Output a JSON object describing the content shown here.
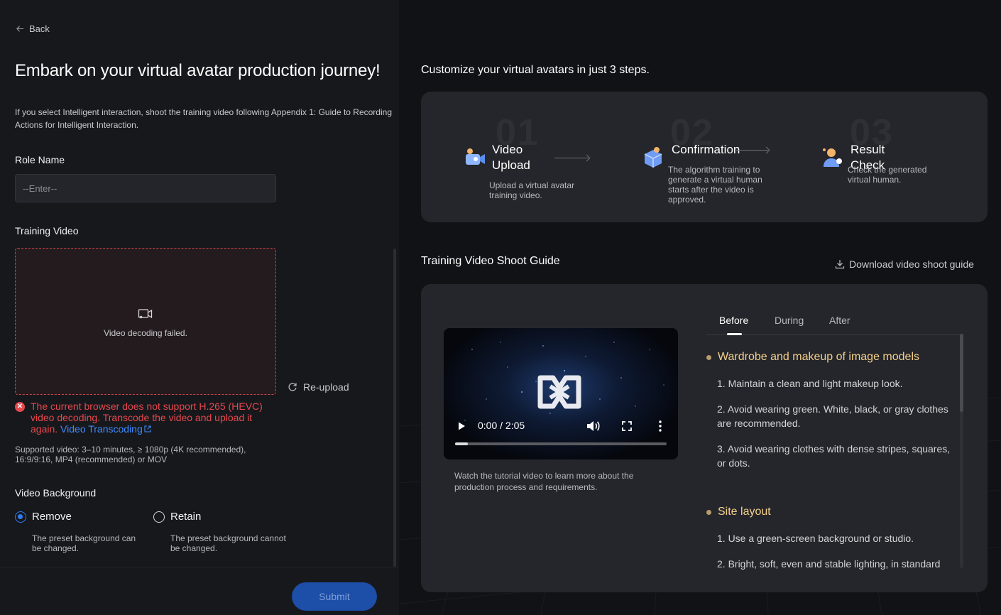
{
  "nav": {
    "back_label": "Back"
  },
  "page": {
    "title": "Embark on your virtual avatar production journey!",
    "intro": "If you select Intelligent interaction, shoot the training video following Appendix 1: Guide to Recording Actions for Intelligent Interaction."
  },
  "form": {
    "role_name_label": "Role Name",
    "role_name_value": "",
    "role_name_placeholder": "--Enter--",
    "training_video_label": "Training Video",
    "upload_status": "Video decoding failed.",
    "reupload_label": "Re-upload",
    "error_text": "The current browser does not support H.265 (HEVC) video decoding. Transcode the video and upload it again.",
    "error_link": "Video Transcoding",
    "support_text": "Supported video: 3–10 minutes, ≥ 1080p (4K recommended), 16:9/9:16, MP4 (recommended) or MOV",
    "background_label": "Video Background",
    "background_options": [
      {
        "label": "Remove",
        "desc": "The preset background can be changed.",
        "selected": true
      },
      {
        "label": "Retain",
        "desc": "The preset background cannot be changed.",
        "selected": false
      }
    ],
    "submit_label": "Submit"
  },
  "steps": {
    "title": "Customize your virtual avatars in just 3 steps.",
    "items": [
      {
        "num": "01",
        "title_line1": "Video",
        "title_line2": "Upload",
        "desc": "Upload a virtual avatar training video.",
        "icon": "video-upload-icon"
      },
      {
        "num": "02",
        "title_line1": "Confirmation",
        "title_line2": "",
        "desc": "The algorithm training to generate a virtual human starts after the video is approved.",
        "icon": "confirmation-box-icon"
      },
      {
        "num": "03",
        "title_line1": "Result Check",
        "title_line2": "",
        "desc": "Check the generated virtual human.",
        "icon": "result-check-icon"
      }
    ]
  },
  "guide": {
    "title": "Training Video Shoot Guide",
    "download_label": "Download video shoot guide",
    "video": {
      "time": "0:00 / 2:05",
      "progress": 0.06
    },
    "video_caption": "Watch the tutorial video to learn more about the production process and requirements.",
    "tabs": [
      "Before",
      "During",
      "After"
    ],
    "active_tab": "Before",
    "sections": [
      {
        "heading": "Wardrobe and makeup of image models",
        "items": [
          "1. Maintain a clean and light makeup look.",
          "2. Avoid wearing green. White, black, or gray clothes are recommended.",
          "3. Avoid wearing clothes with dense stripes, squares, or dots."
        ]
      },
      {
        "heading": "Site layout",
        "items": [
          "1. Use a green-screen background or studio.",
          "2. Bright, soft, even and stable lighting, in standard"
        ]
      }
    ]
  },
  "colors": {
    "accent": "#2f7cf6",
    "error": "#e5484d",
    "link": "#3e8bff",
    "section_heading": "#f3cf8c",
    "submit_bg": "#1d4ea8"
  }
}
